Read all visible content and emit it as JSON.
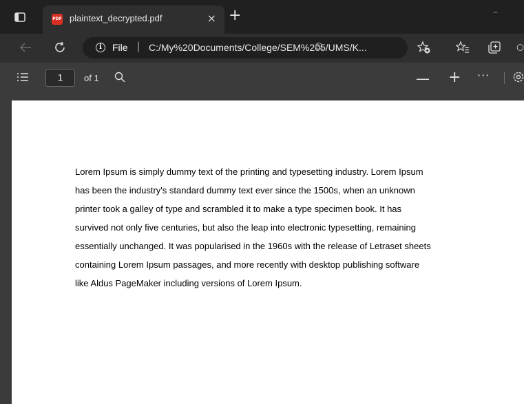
{
  "tab": {
    "title": "plaintext_decrypted.pdf",
    "favicon_label": "PDF",
    "close_glyph": "×",
    "new_tab_glyph": "+"
  },
  "window": {
    "minimize_glyph": "–"
  },
  "address": {
    "scheme": "File",
    "separator": "|",
    "url": "C:/My%20Documents/College/SEM%205/UMS/K..."
  },
  "pdf_toolbar": {
    "page_number": "1",
    "page_of": "of 1",
    "zoom_out_glyph": "—",
    "zoom_in_glyph": "+",
    "more_glyph": "···"
  },
  "document": {
    "body": "Lorem Ipsum is simply dummy text of the printing and typesetting industry. Lorem Ipsum\nhas been the industry's standard dummy text ever since the 1500s, when an unknown\nprinter took a galley of type and scrambled it to make a type specimen book. It has\nsurvived not only five centuries, but also the leap into electronic typesetting, remaining\nessentially unchanged. It was popularised in the 1960s with the release of Letraset sheets\ncontaining Lorem Ipsum passages, and more recently with desktop publishing software\nlike Aldus PageMaker including versions of Lorem Ipsum."
  },
  "icons": {
    "tab_actions": "tab-actions-icon",
    "back": "back-arrow-icon",
    "refresh": "refresh-icon",
    "info": "info-icon",
    "zoom": "zoom-icon",
    "favorites_add": "add-favorite-icon",
    "favorites": "favorites-icon",
    "collections": "collections-icon",
    "toc": "table-of-contents-icon",
    "search": "search-icon",
    "settings": "settings-icon"
  },
  "colors": {
    "pdf_badge": "#d93025",
    "tab_bar": "#202020",
    "address_bar": "#2f2f2f",
    "toolbar": "#3b3b3b",
    "page": "#ffffff"
  }
}
